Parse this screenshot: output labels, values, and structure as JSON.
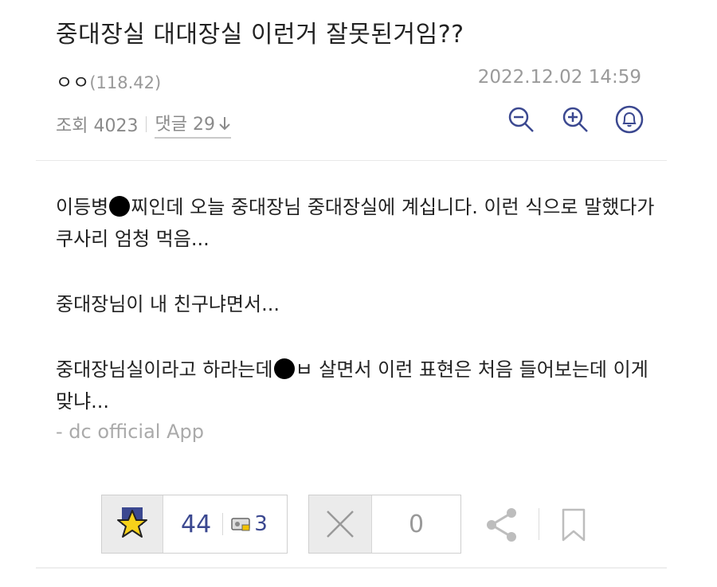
{
  "post": {
    "title": "중대장실 대대장실 이런거 잘못된거임??",
    "author_name": "ㅇㅇ",
    "author_ip": "(118.42)",
    "date": "2022.12.02 14:59",
    "views_label": "조회 4023",
    "comments_label": "댓글 29",
    "body": {
      "p1_a": "이등병",
      "p1_b": "찌인데 오늘 중대장님 중대장실에 계십니다. 이런 식으로 말했다가 쿠사리 엄청 먹음...",
      "p2": "중대장님이 내 친구냐면서...",
      "p3_a": "중대장님실이라고 하라는데",
      "p3_b": "ㅂ 살면서 이런 표현은 처음 들어보는데 이게 맞냐..."
    },
    "signature": "- dc official App"
  },
  "actions": {
    "upvote_count": "44",
    "fixed_count": "3",
    "downvote_count": "0"
  },
  "icons": {
    "zoom_out": "zoom-out-icon",
    "zoom_in": "zoom-in-icon",
    "alarm": "bell-icon",
    "upvote": "star-icon",
    "fixed": "fixed-user-icon",
    "downvote": "x-icon",
    "share": "share-icon",
    "bookmark": "bookmark-icon"
  },
  "colors": {
    "accent": "#3b4890",
    "star_fill": "#f7d21a",
    "muted": "#999999"
  }
}
